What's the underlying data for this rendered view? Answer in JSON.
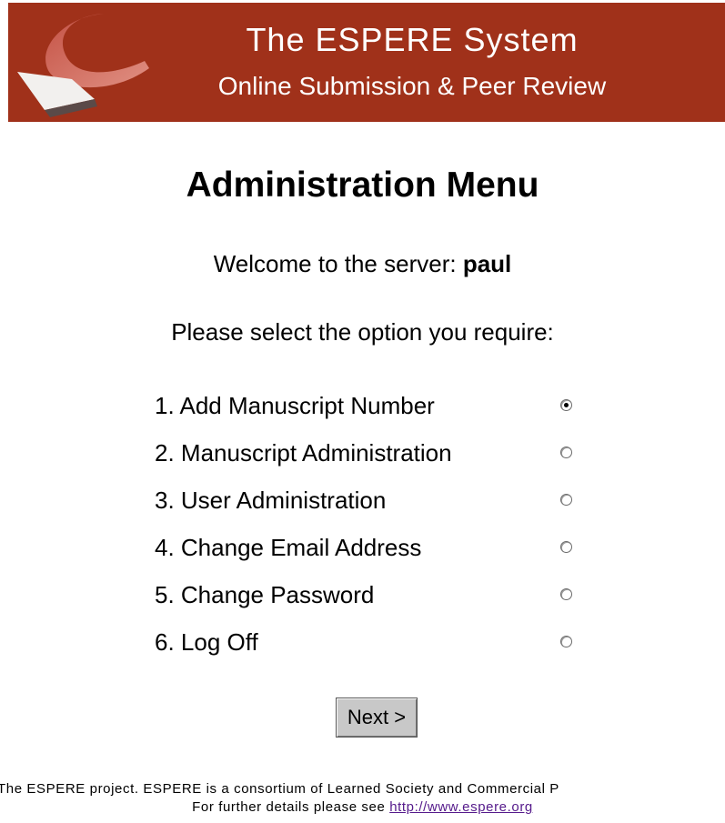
{
  "header": {
    "title": "The ESPERE System",
    "subtitle": "Online Submission & Peer Review",
    "logo_icon": "curved-page-swoosh-logo",
    "background_color": "#a0311a"
  },
  "main": {
    "heading": "Administration Menu",
    "welcome_text": "Welcome to the server: ",
    "username": "paul",
    "prompt": "Please select the option you require:",
    "options": [
      {
        "label": "1. Add Manuscript Number",
        "checked": true
      },
      {
        "label": "2. Manuscript Administration",
        "checked": false
      },
      {
        "label": "3. User Administration",
        "checked": false
      },
      {
        "label": "4. Change Email Address",
        "checked": false
      },
      {
        "label": "5. Change Password",
        "checked": false
      },
      {
        "label": "6. Log Off",
        "checked": false
      }
    ],
    "next_label": "Next >"
  },
  "footer": {
    "line1": "The ESPERE project. ESPERE is a consortium of Learned Society and Commercial P",
    "line2_prefix": "For further details please see ",
    "link_text": "http://www.espere.org",
    "link_color": "#551a8b"
  }
}
